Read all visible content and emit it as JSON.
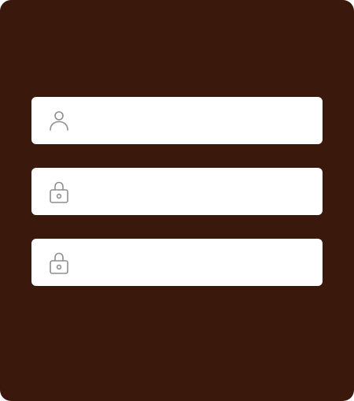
{
  "theme": {
    "background": "#3a180c",
    "field_background": "#ffffff",
    "icon_color": "#8e8e8e"
  },
  "form": {
    "fields": [
      {
        "icon": "user-icon",
        "value": "",
        "placeholder": ""
      },
      {
        "icon": "lock-icon",
        "value": "",
        "placeholder": ""
      },
      {
        "icon": "lock-icon",
        "value": "",
        "placeholder": ""
      }
    ]
  }
}
